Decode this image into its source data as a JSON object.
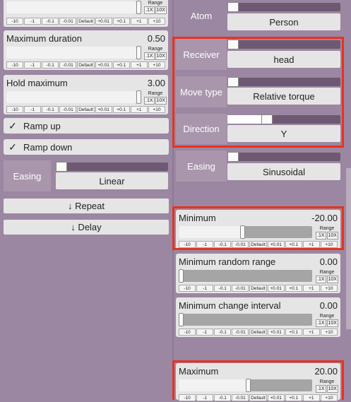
{
  "range_label": "Range",
  "range_buttons": [
    ".1X",
    "10X"
  ],
  "steps": [
    "-10",
    "-1",
    "-0.1",
    "-0.01",
    "Default",
    "+0.01",
    "+0.1",
    "+1",
    "+10"
  ],
  "left": {
    "top_panel": {
      "fill_pct": 97
    },
    "max_duration": {
      "label": "Maximum duration",
      "value": "0.50",
      "fill_pct": 97
    },
    "hold_max": {
      "label": "Hold maximum",
      "value": "3.00",
      "fill_pct": 97
    },
    "ramp_up": {
      "label": "Ramp up",
      "checked": true,
      "check_glyph": "✓"
    },
    "ramp_down": {
      "label": "Ramp down",
      "checked": true,
      "check_glyph": "✓"
    },
    "easing": {
      "label": "Easing",
      "value": "Linear"
    },
    "repeat_button": "↓ Repeat",
    "delay_button": "↓ Delay"
  },
  "right": {
    "atom": {
      "label": "Atom",
      "value": "Person"
    },
    "receiver": {
      "label": "Receiver",
      "value": "head"
    },
    "move_type": {
      "label": "Move type",
      "value": "Relative torque"
    },
    "direction": {
      "label": "Direction",
      "value": "Y"
    },
    "easing": {
      "label": "Easing",
      "value": "Sinusoidal"
    },
    "minimum": {
      "label": "Minimum",
      "value": "-20.00",
      "fill_pct": 48
    },
    "min_random_range": {
      "label": "Minimum random range",
      "value": "0.00",
      "fill_pct": 0
    },
    "min_change_interval": {
      "label": "Minimum change interval",
      "value": "0.00",
      "fill_pct": 0
    },
    "maximum": {
      "label": "Maximum",
      "value": "20.00",
      "fill_pct": 52
    }
  },
  "colors": {
    "highlight": "#e8321e",
    "panel_bg": "#9b87a1"
  }
}
